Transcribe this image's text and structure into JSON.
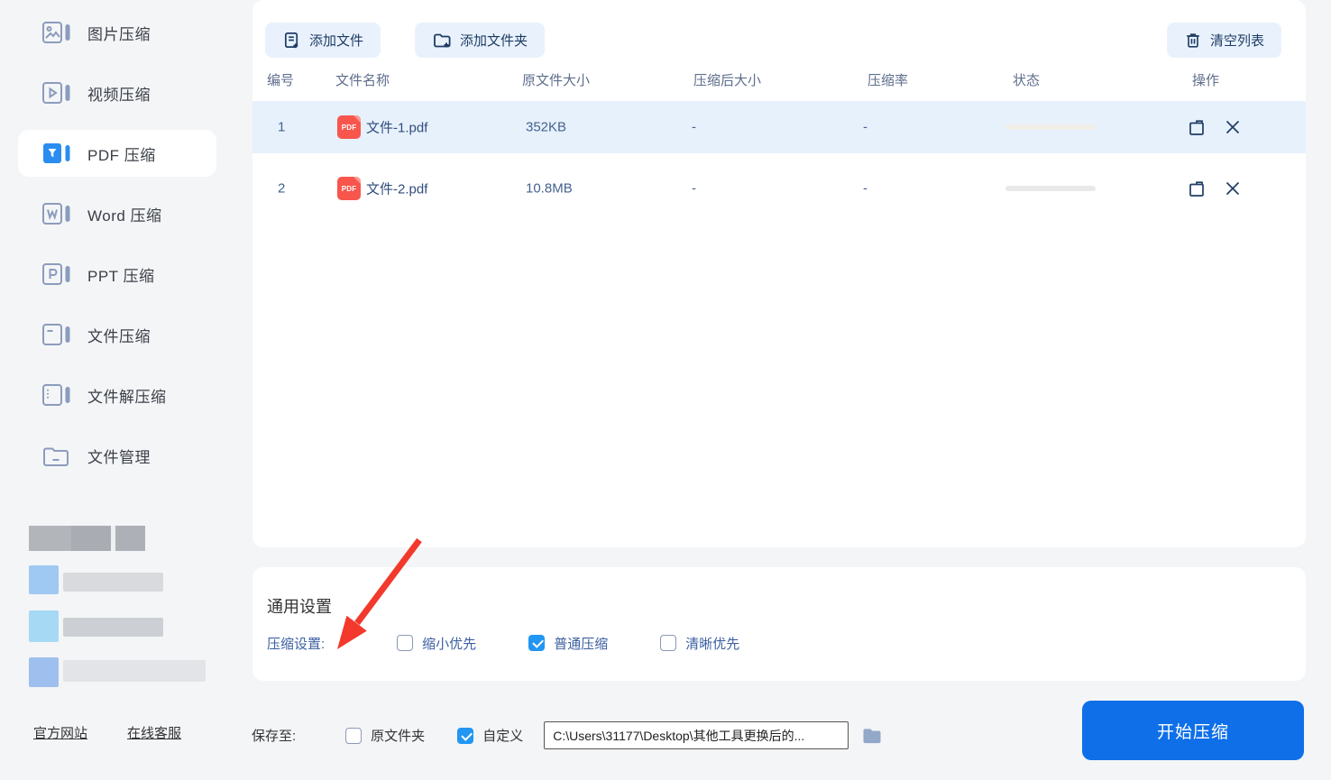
{
  "sidebar": {
    "items": [
      {
        "label": "图片压缩",
        "icon": "image-compress-icon",
        "selected": false
      },
      {
        "label": "视频压缩",
        "icon": "video-compress-icon",
        "selected": false
      },
      {
        "label": "PDF 压缩",
        "icon": "pdf-compress-icon",
        "selected": true
      },
      {
        "label": "Word 压缩",
        "icon": "word-compress-icon",
        "selected": false
      },
      {
        "label": "PPT 压缩",
        "icon": "ppt-compress-icon",
        "selected": false
      },
      {
        "label": "文件压缩",
        "icon": "file-compress-icon",
        "selected": false
      },
      {
        "label": "文件解压缩",
        "icon": "file-extract-icon",
        "selected": false
      },
      {
        "label": "文件管理",
        "icon": "file-manage-icon",
        "selected": false
      }
    ],
    "links": [
      {
        "label": "官方网站"
      },
      {
        "label": "在线客服"
      }
    ]
  },
  "toolbar": {
    "add_file": "添加文件",
    "add_folder": "添加文件夹",
    "clear_list": "清空列表"
  },
  "table": {
    "headers": [
      "编号",
      "文件名称",
      "原文件大小",
      "压缩后大小",
      "压缩率",
      "状态",
      "操作"
    ],
    "rows": [
      {
        "no": "1",
        "file_type": "PDF",
        "name": "文件-1.pdf",
        "original_size": "352KB",
        "compressed_size": "-",
        "ratio": "-",
        "status_progress": 0
      },
      {
        "no": "2",
        "file_type": "PDF",
        "name": "文件-2.pdf",
        "original_size": "10.8MB",
        "compressed_size": "-",
        "ratio": "-",
        "status_progress": 0
      }
    ]
  },
  "settings": {
    "title": "通用设置",
    "compression_label": "压缩设置:",
    "options": [
      {
        "label": "缩小优先",
        "checked": false
      },
      {
        "label": "普通压缩",
        "checked": true
      },
      {
        "label": "清晰优先",
        "checked": false
      }
    ]
  },
  "footer": {
    "save_to_label": "保存至:",
    "options": [
      {
        "label": "原文件夹",
        "checked": false
      },
      {
        "label": "自定义",
        "checked": true
      }
    ],
    "path_value": "C:\\Users\\31177\\Desktop\\其他工具更换后的...",
    "start_button": "开始压缩"
  },
  "colors": {
    "accent_blue": "#2196f3",
    "primary_button": "#0e6fe9",
    "sidebar_active_icon": "#2b8df0",
    "row_highlight": "#e7f1fc",
    "tool_button_bg": "#e9f2fc",
    "navy_text": "#1e3c64",
    "pdf_file_icon": "#f8564d",
    "annotation_arrow": "#f2392c"
  }
}
